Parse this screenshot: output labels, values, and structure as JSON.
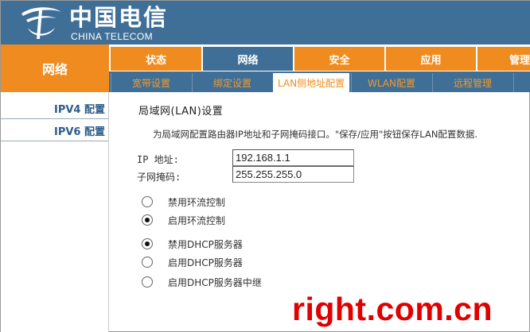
{
  "brand": {
    "name_cn": "中国电信",
    "name_en": "CHINA TELECOM"
  },
  "section_title": "网络",
  "main_tabs": [
    {
      "label": "状态",
      "active": false
    },
    {
      "label": "网络",
      "active": true
    },
    {
      "label": "安全",
      "active": false
    },
    {
      "label": "应用",
      "active": false
    },
    {
      "label": "管理",
      "active": false
    }
  ],
  "sub_tabs": [
    {
      "label": "宽带设置",
      "active": false
    },
    {
      "label": "绑定设置",
      "active": false
    },
    {
      "label": "LAN侧地址配置",
      "active": true
    },
    {
      "label": "WLAN配置",
      "active": false
    },
    {
      "label": "远程管理",
      "active": false
    }
  ],
  "sidebar": {
    "items": [
      {
        "label": "IPV4 配置"
      },
      {
        "label": "IPV6 配置"
      }
    ]
  },
  "content": {
    "title": "局域网(LAN)设置",
    "description": "为局域网配置路由器IP地址和子网掩码接口。\"保存/应用\"按钮保存LAN配置数据.",
    "fields": [
      {
        "label": "IP 地址:",
        "value": "192.168.1.1"
      },
      {
        "label": "子网掩码:",
        "value": "255.255.255.0"
      }
    ],
    "loop_control": [
      {
        "label": "禁用环流控制",
        "checked": false
      },
      {
        "label": "启用环流控制",
        "checked": true
      }
    ],
    "dhcp": [
      {
        "label": "禁用DHCP服务器",
        "checked": true
      },
      {
        "label": "启用DHCP服务器",
        "checked": false
      },
      {
        "label": "启用DHCP服务器中继",
        "checked": false
      }
    ]
  },
  "watermark": "right.com.cn",
  "colors": {
    "header_blue": "#3f6f97",
    "accent_orange": "#f08c1f",
    "sidebar_text": "#2d5c8a",
    "watermark_red": "#e00000"
  }
}
